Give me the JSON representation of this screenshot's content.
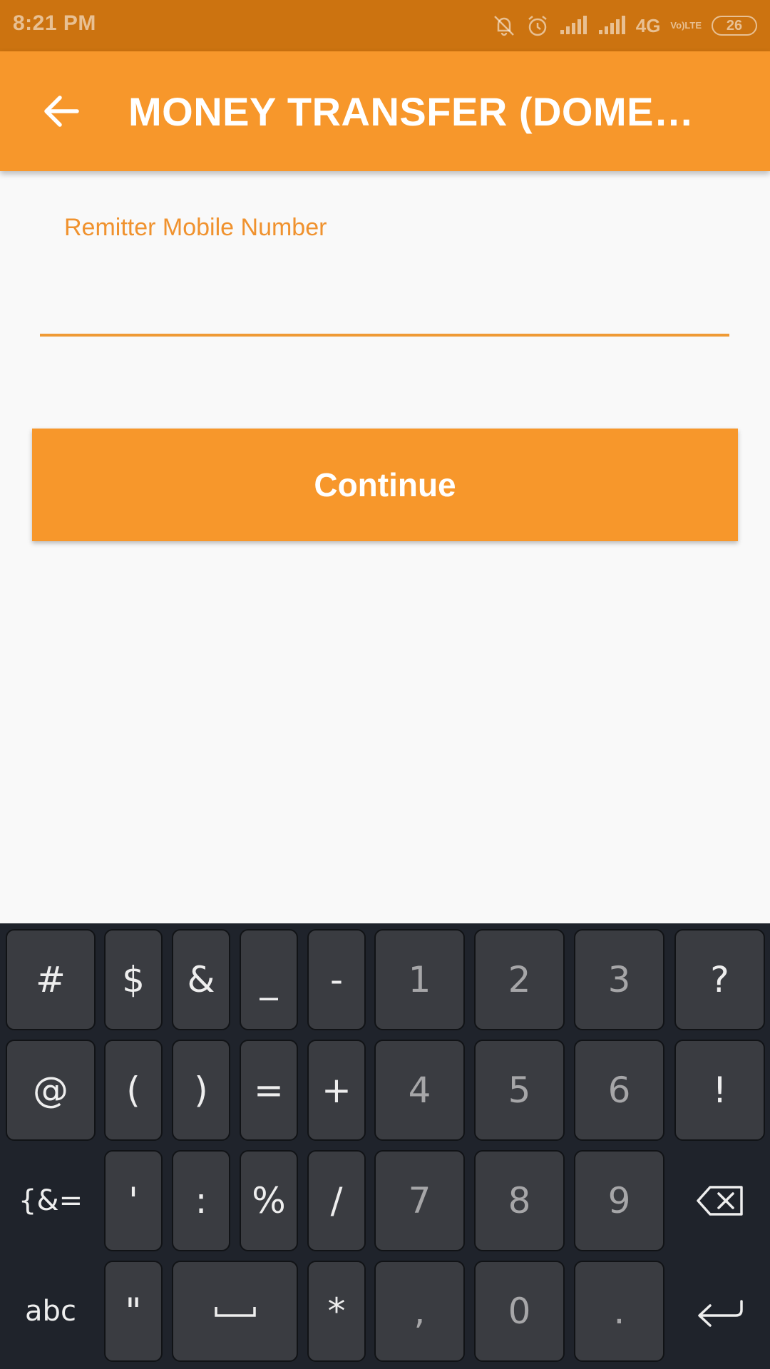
{
  "status_bar": {
    "time": "8:21 PM",
    "network": "4G",
    "volte_top": "Vo)",
    "volte_bottom": "LTE",
    "battery": "26",
    "icons": [
      "mute-alert-icon",
      "alarm-icon",
      "signal-icon",
      "signal-icon",
      "volte-icon",
      "battery-icon"
    ]
  },
  "app_bar": {
    "title": "MONEY TRANSFER (DOMESTIC)",
    "back_icon": "arrow-left-icon"
  },
  "form": {
    "label": "Remitter Mobile Number",
    "value": "",
    "placeholder": "",
    "continue_label": "Continue"
  },
  "colors": {
    "primary": "#f7972b",
    "status_bar": "#cc7310",
    "keyboard_bg": "#1f232b",
    "key_bg": "#3a3c41"
  },
  "keyboard": {
    "row1": [
      "#",
      "$",
      "&",
      "_",
      "-",
      "1",
      "2",
      "3",
      "?"
    ],
    "row2": [
      "@",
      "(",
      ")",
      "=",
      "+",
      "4",
      "5",
      "6",
      "!"
    ],
    "row3": [
      "{&=",
      "'",
      ":",
      "%",
      "/",
      "7",
      "8",
      "9"
    ],
    "row4": [
      "abc",
      "\"",
      "*",
      ",",
      "0",
      "."
    ],
    "special_icons": {
      "delete": "backspace-icon",
      "space": "space-bar-icon",
      "enter": "enter-icon"
    }
  }
}
